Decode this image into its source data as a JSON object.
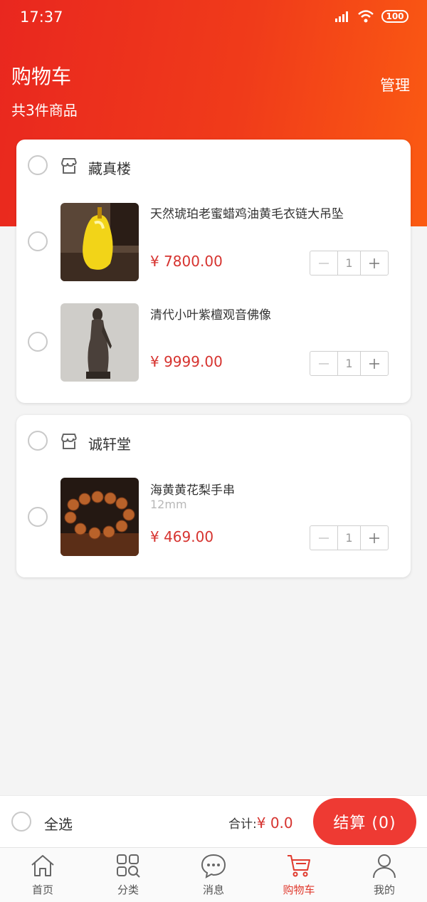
{
  "status_bar": {
    "time": "17:37",
    "battery": "100",
    "icons": [
      "signal-icon",
      "wifi-icon",
      "battery-icon"
    ]
  },
  "header": {
    "title": "购物车",
    "count_text": "共3件商品",
    "manage_label": "管理"
  },
  "colors": {
    "brand": "#ee3a33",
    "price": "#d6332f",
    "tab_active": "#e03a2e"
  },
  "shops": [
    {
      "name": "藏真楼",
      "items": [
        {
          "name": "天然琥珀老蜜蜡鸡油黄毛衣链大吊坠",
          "spec": "",
          "price": "¥ 7800.00",
          "qty": "1"
        },
        {
          "name": " 清代小叶紫檀观音佛像",
          "spec": "",
          "price": "¥ 9999.00",
          "qty": "1"
        }
      ]
    },
    {
      "name": "诚轩堂",
      "items": [
        {
          "name": "海黄黄花梨手串",
          "spec": "12mm",
          "price": "¥ 469.00",
          "qty": "1"
        }
      ]
    }
  ],
  "checkout": {
    "select_all_label": "全选",
    "total_label": "合计:",
    "total_value": "¥ 0.0",
    "button_label": "结算 (0)"
  },
  "tabbar": [
    {
      "label": "首页",
      "icon": "home-icon"
    },
    {
      "label": "分类",
      "icon": "category-icon"
    },
    {
      "label": "消息",
      "icon": "message-icon"
    },
    {
      "label": "购物车",
      "icon": "cart-icon",
      "active": true
    },
    {
      "label": "我的",
      "icon": "profile-icon"
    }
  ]
}
